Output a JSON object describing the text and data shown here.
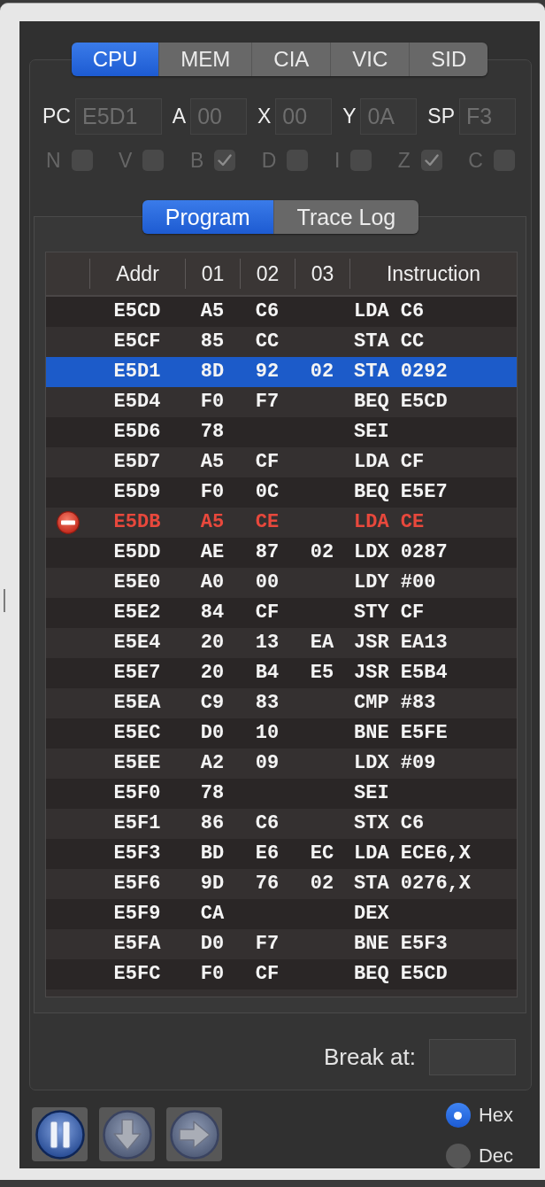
{
  "tabs": [
    {
      "label": "CPU",
      "selected": true
    },
    {
      "label": "MEM",
      "selected": false
    },
    {
      "label": "CIA",
      "selected": false
    },
    {
      "label": "VIC",
      "selected": false
    },
    {
      "label": "SID",
      "selected": false
    }
  ],
  "registers": [
    {
      "label": "PC",
      "value": "E5D1",
      "disabled": true
    },
    {
      "label": "A",
      "value": "00",
      "disabled": true
    },
    {
      "label": "X",
      "value": "00",
      "disabled": true
    },
    {
      "label": "Y",
      "value": "0A",
      "disabled": true
    },
    {
      "label": "SP",
      "value": "F3",
      "disabled": true
    }
  ],
  "flags": [
    {
      "label": "N",
      "checked": false,
      "disabled": true
    },
    {
      "label": "V",
      "checked": false,
      "disabled": true
    },
    {
      "label": "B",
      "checked": true,
      "disabled": true
    },
    {
      "label": "D",
      "checked": false,
      "disabled": true
    },
    {
      "label": "I",
      "checked": false,
      "disabled": true
    },
    {
      "label": "Z",
      "checked": true,
      "disabled": true
    },
    {
      "label": "C",
      "checked": false,
      "disabled": true
    }
  ],
  "view_tabs": [
    {
      "label": "Program",
      "selected": true
    },
    {
      "label": "Trace Log",
      "selected": false
    }
  ],
  "table": {
    "columns": [
      "Addr",
      "01",
      "02",
      "03",
      "Instruction"
    ],
    "rows": [
      {
        "addr": "E5CD",
        "bytes": [
          "A5",
          "C6"
        ],
        "instruction": "LDA C6",
        "selected": false,
        "breakpoint": false
      },
      {
        "addr": "E5CF",
        "bytes": [
          "85",
          "CC"
        ],
        "instruction": "STA CC",
        "selected": false,
        "breakpoint": false
      },
      {
        "addr": "E5D1",
        "bytes": [
          "8D",
          "92",
          "02"
        ],
        "instruction": "STA 0292",
        "selected": true,
        "breakpoint": false
      },
      {
        "addr": "E5D4",
        "bytes": [
          "F0",
          "F7"
        ],
        "instruction": "BEQ E5CD",
        "selected": false,
        "breakpoint": false
      },
      {
        "addr": "E5D6",
        "bytes": [
          "78"
        ],
        "instruction": "SEI",
        "selected": false,
        "breakpoint": false
      },
      {
        "addr": "E5D7",
        "bytes": [
          "A5",
          "CF"
        ],
        "instruction": "LDA CF",
        "selected": false,
        "breakpoint": false
      },
      {
        "addr": "E5D9",
        "bytes": [
          "F0",
          "0C"
        ],
        "instruction": "BEQ E5E7",
        "selected": false,
        "breakpoint": false
      },
      {
        "addr": "E5DB",
        "bytes": [
          "A5",
          "CE"
        ],
        "instruction": "LDA CE",
        "selected": false,
        "breakpoint": true
      },
      {
        "addr": "E5DD",
        "bytes": [
          "AE",
          "87",
          "02"
        ],
        "instruction": "LDX 0287",
        "selected": false,
        "breakpoint": false
      },
      {
        "addr": "E5E0",
        "bytes": [
          "A0",
          "00"
        ],
        "instruction": "LDY #00",
        "selected": false,
        "breakpoint": false
      },
      {
        "addr": "E5E2",
        "bytes": [
          "84",
          "CF"
        ],
        "instruction": "STY CF",
        "selected": false,
        "breakpoint": false
      },
      {
        "addr": "E5E4",
        "bytes": [
          "20",
          "13",
          "EA"
        ],
        "instruction": "JSR EA13",
        "selected": false,
        "breakpoint": false
      },
      {
        "addr": "E5E7",
        "bytes": [
          "20",
          "B4",
          "E5"
        ],
        "instruction": "JSR E5B4",
        "selected": false,
        "breakpoint": false
      },
      {
        "addr": "E5EA",
        "bytes": [
          "C9",
          "83"
        ],
        "instruction": "CMP #83",
        "selected": false,
        "breakpoint": false
      },
      {
        "addr": "E5EC",
        "bytes": [
          "D0",
          "10"
        ],
        "instruction": "BNE E5FE",
        "selected": false,
        "breakpoint": false
      },
      {
        "addr": "E5EE",
        "bytes": [
          "A2",
          "09"
        ],
        "instruction": "LDX #09",
        "selected": false,
        "breakpoint": false
      },
      {
        "addr": "E5F0",
        "bytes": [
          "78"
        ],
        "instruction": "SEI",
        "selected": false,
        "breakpoint": false
      },
      {
        "addr": "E5F1",
        "bytes": [
          "86",
          "C6"
        ],
        "instruction": "STX C6",
        "selected": false,
        "breakpoint": false
      },
      {
        "addr": "E5F3",
        "bytes": [
          "BD",
          "E6",
          "EC"
        ],
        "instruction": "LDA ECE6,X",
        "selected": false,
        "breakpoint": false
      },
      {
        "addr": "E5F6",
        "bytes": [
          "9D",
          "76",
          "02"
        ],
        "instruction": "STA 0276,X",
        "selected": false,
        "breakpoint": false
      },
      {
        "addr": "E5F9",
        "bytes": [
          "CA"
        ],
        "instruction": "DEX",
        "selected": false,
        "breakpoint": false
      },
      {
        "addr": "E5FA",
        "bytes": [
          "D0",
          "F7"
        ],
        "instruction": "BNE E5F3",
        "selected": false,
        "breakpoint": false
      },
      {
        "addr": "E5FC",
        "bytes": [
          "F0",
          "CF"
        ],
        "instruction": "BEQ E5CD",
        "selected": false,
        "breakpoint": false
      }
    ]
  },
  "break_at": {
    "label": "Break at:"
  },
  "controls": [
    {
      "kind": "pause",
      "disabled": false
    },
    {
      "kind": "down",
      "disabled": true
    },
    {
      "kind": "right",
      "disabled": true
    }
  ],
  "radix": [
    {
      "label": "Hex",
      "selected": true
    },
    {
      "label": "Dec",
      "selected": false
    }
  ]
}
